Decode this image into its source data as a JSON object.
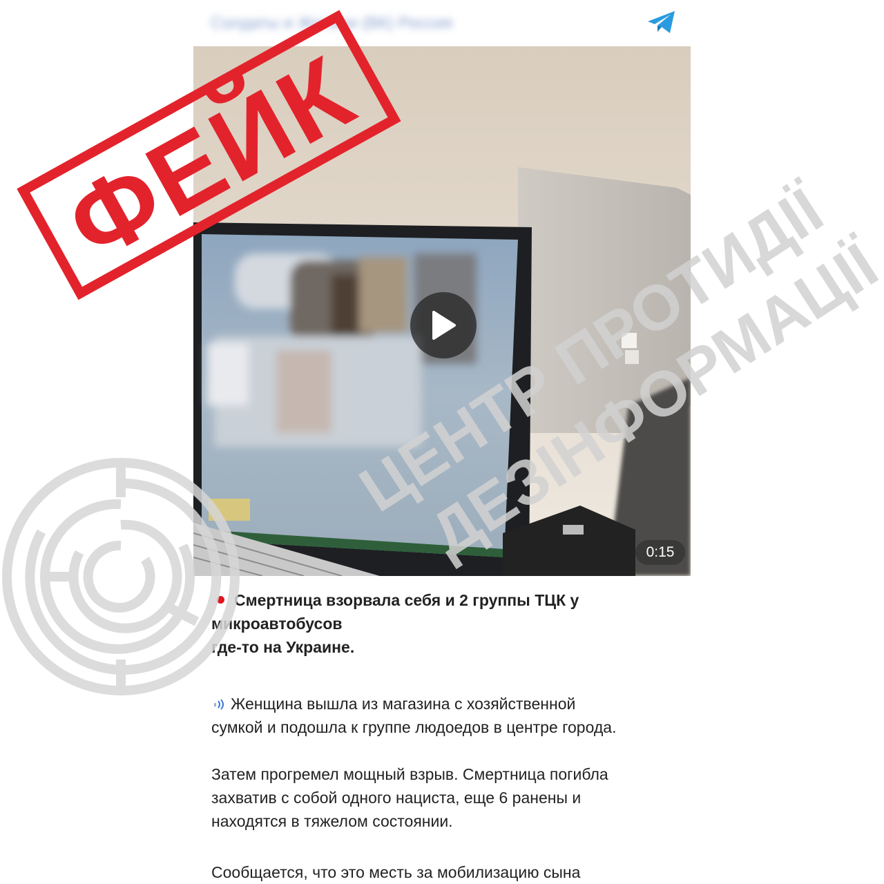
{
  "header": {
    "channel_name": "Солдаты и Жители (ВК) Россия",
    "telegram_icon": "telegram-paper-plane-icon"
  },
  "video": {
    "duration": "0:15",
    "play_icon": "play-icon"
  },
  "post": {
    "headline_line1": "Смертница взорвала себя и 2 группы ТЦК у",
    "headline_line2": "микроавтобусов",
    "headline_line3": "где-то на Украине.",
    "paragraph1": "Женщина вышла из магазина с хозяйственной\nсумкой и подошла к группе людоедов в центре города.",
    "paragraph2": "Затем прогремел мощный взрыв. Смертница погибла\nзахватив с собой одного нациста, еще 6 ранены и\nнаходятся в тяжелом состоянии.",
    "paragraph3": "Сообщается, что это месть за мобилизацию сына"
  },
  "overlay": {
    "stamp_text": "ФЕЙК",
    "watermark_line1": "ЦЕНТР ПРОТИДІЇ",
    "watermark_line2": "ДЕЗІНФОРМАЦІЇ"
  },
  "colors": {
    "stamp_red": "#e3232c",
    "telegram_blue": "#2a9be0",
    "watermark_gray": "#d9d9d9"
  }
}
